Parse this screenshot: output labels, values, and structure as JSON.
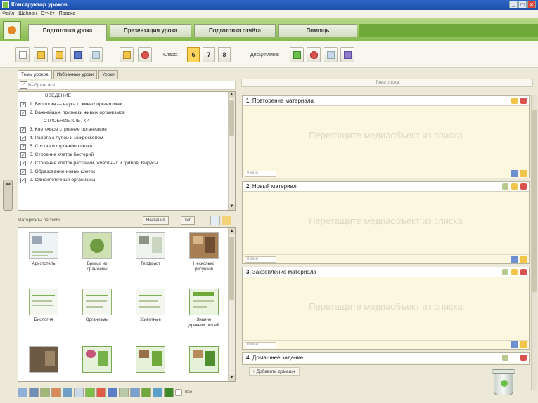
{
  "window": {
    "title": "Конструктор уроков"
  },
  "menu": [
    "Файл",
    "Шаблон",
    "Отчёт",
    "Правка"
  ],
  "main_tabs": [
    "Подготовка урока",
    "Презентация урока",
    "Подготовка отчёта",
    "Помощь"
  ],
  "toolbar": {
    "class_label": "Класс:",
    "grades": [
      "6",
      "7",
      "8"
    ],
    "discipline_label": "Дисциплина:"
  },
  "left": {
    "subtabs": [
      "Темы уроков",
      "Избранные уроки",
      "Уроки"
    ],
    "select_all": "Выбрать всё",
    "topics": [
      {
        "text": "ВВЕДЕНИЕ",
        "section": true
      },
      {
        "text": "1. Биология — наука о живых организмах",
        "checked": true
      },
      {
        "text": "2. Важнейшие признаки живых организмов",
        "checked": true
      },
      {
        "text": "СТРОЕНИЕ КЛЕТКИ",
        "section": true
      },
      {
        "text": "3. Клеточное строение организмов",
        "checked": true
      },
      {
        "text": "4. Работа с лупой и микроскопом",
        "checked": true
      },
      {
        "text": "5. Состав и строение клетки",
        "checked": true
      },
      {
        "text": "6. Строение клеток бактерий",
        "checked": true
      },
      {
        "text": "7. Строение клеток растений, животных и грибов. Вирусы",
        "checked": true
      },
      {
        "text": "8. Образование новых клеток",
        "checked": true
      },
      {
        "text": "9. Одноклеточные организмы",
        "checked": true
      }
    ],
    "materials_header": "Материалы по теме",
    "materials_buttons": [
      "Название",
      "Тип"
    ],
    "materials": [
      {
        "label": "Аристотель"
      },
      {
        "label": "Бриозо из\nоранжевы"
      },
      {
        "label": "Теофраст"
      },
      {
        "label": "Несколько\nрисунков"
      },
      {
        "label": "Биология"
      },
      {
        "label": "Организмы"
      },
      {
        "label": "Животные"
      },
      {
        "label": "Знание\nдревних людей"
      },
      {
        "label": ""
      },
      {
        "label": ""
      },
      {
        "label": ""
      },
      {
        "label": ""
      }
    ],
    "bottom_label": "Все"
  },
  "right": {
    "header": "Тема урока",
    "drop_hint": "Перетащите медиаобъект из списка",
    "time_placeholder": "0 мин",
    "blocks": [
      {
        "num": "1.",
        "title": "Повторение материала"
      },
      {
        "num": "2.",
        "title": "Новый материал"
      },
      {
        "num": "3.",
        "title": "Закрепление материала"
      },
      {
        "num": "4.",
        "title": "Домашнее задание"
      }
    ],
    "add_homework": "Добавить домашн"
  }
}
